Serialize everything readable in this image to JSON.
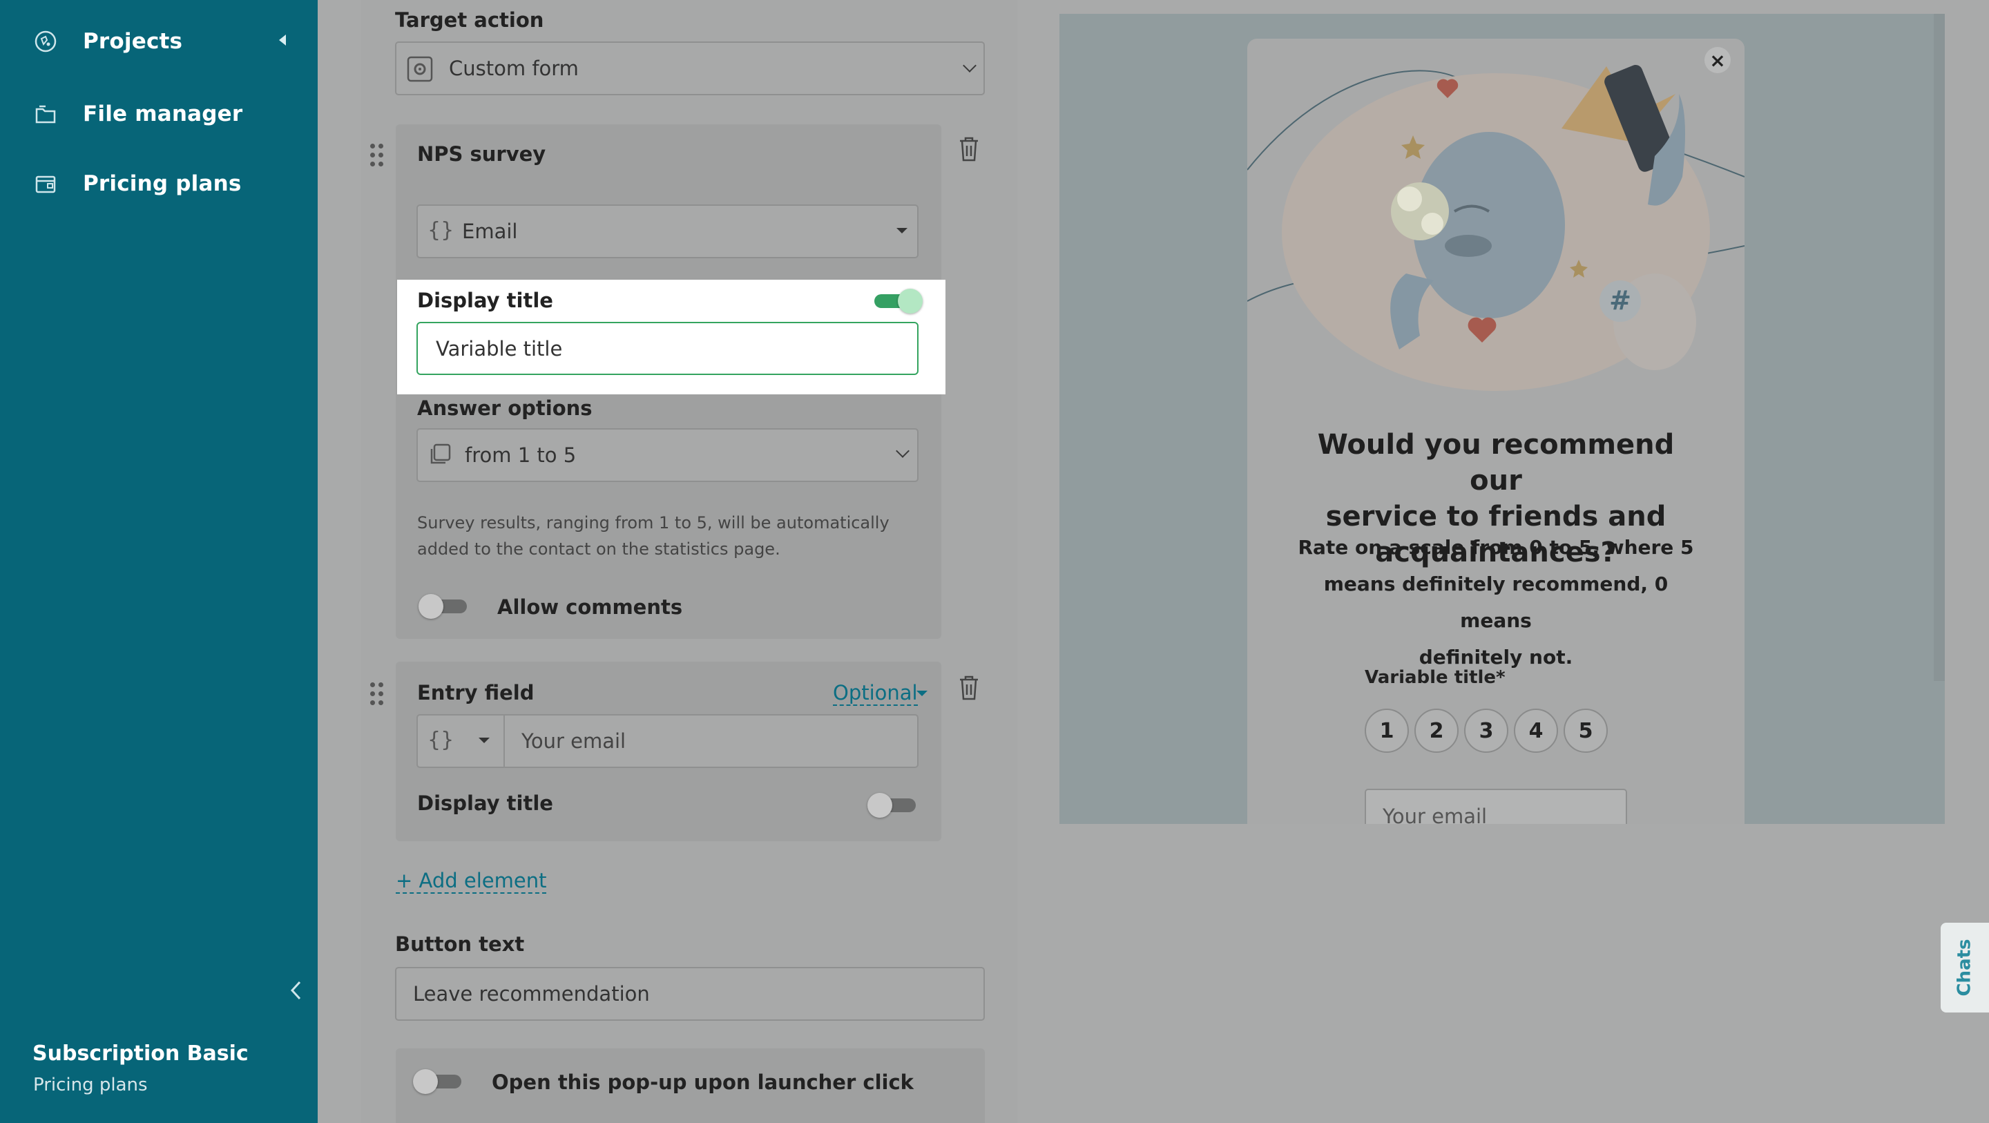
{
  "sidebar": {
    "items": [
      {
        "label": "Projects",
        "icon": "projects-icon"
      },
      {
        "label": "File manager",
        "icon": "folder-icon"
      },
      {
        "label": "Pricing plans",
        "icon": "wallet-icon"
      }
    ],
    "subscription_name": "Subscription Basic",
    "subscription_link": "Pricing plans"
  },
  "settings": {
    "target_action_label": "Target action",
    "target_action_value": "Custom form",
    "nps_card": {
      "title": "NPS survey",
      "variable_value": "Email",
      "display_title_label": "Display title",
      "display_title_on": true,
      "title_input_value": "Variable title",
      "answer_options_label": "Answer options",
      "answer_options_value": "from 1 to 5",
      "help_line1": "Survey results, ranging from 1 to 5, will be automatically",
      "help_line2": "added to the contact on the statistics page.",
      "allow_comments_label": "Allow comments",
      "allow_comments_on": false
    },
    "entry_card": {
      "title": "Entry field",
      "optional_label": "Optional",
      "placeholder": "Your email",
      "display_title_label": "Display title",
      "display_title_on": false
    },
    "add_element": "+ Add element",
    "button_text_label": "Button text",
    "button_text_value": "Leave recommendation",
    "launcher_label": "Open this pop-up upon launcher click",
    "launcher_on": false
  },
  "preview": {
    "close": "×",
    "heading_line1": "Would you recommend our",
    "heading_line2": "service to friends and",
    "heading_line3": "acquaintances?",
    "sub_line1": "Rate on a scale from 0 to 5, where 5",
    "sub_line2": "means definitely recommend, 0 means",
    "sub_line3": "definitely not.",
    "variable_label": "Variable title*",
    "ratings": [
      "1",
      "2",
      "3",
      "4",
      "5"
    ],
    "email_placeholder": "Your email",
    "hashtag": "#"
  },
  "chats_label": "Chats",
  "colors": {
    "sidebar_bg": "#076578",
    "accent_green": "#35a063",
    "link_teal": "#0c6e83"
  }
}
